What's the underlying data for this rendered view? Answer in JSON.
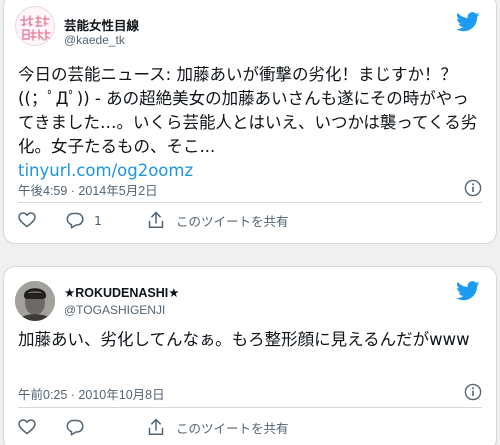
{
  "theme": {
    "background": "#f0f0f0",
    "card_background": "#ffffff",
    "text_color": "#0f1419",
    "secondary_color": "#536471",
    "link_color": "#1b95e0",
    "twitter_blue": "#1d9bf0",
    "avatar_logo_color": "#e8839f"
  },
  "tweets": [
    {
      "avatar": {
        "type": "logo",
        "text": "女性目線"
      },
      "author_name": "芸能女性目線",
      "handle": "@kaede_tk",
      "text": "今日の芸能ニュース: 加藤あいが衝撃の劣化！まじすか！？((；ﾟДﾟ)) - あの超絶美女の加藤あいさんも遂にその時がやってきました…。いくら芸能人とはいえ、いつかは襲ってくる劣化。女子たるもの、そこ...",
      "link": "tinyurl.com/og2oomz",
      "timestamp": "午後4:59 · 2014年5月2日",
      "reply_count": "1",
      "share_label": "このツイートを共有"
    },
    {
      "avatar": {
        "type": "photo"
      },
      "author_name": "★ROKUDENASHI★",
      "handle": "@TOGASHIGENJI",
      "text": "加藤あい、劣化してんなぁ。もろ整形顔に見えるんだがwww",
      "timestamp": "午前0:25 · 2010年10月8日",
      "reply_count": "",
      "share_label": "このツイートを共有"
    }
  ],
  "icons": {
    "brand": "twitter-bird-icon",
    "info": "info-icon",
    "like": "heart-icon",
    "reply": "speech-bubble-icon",
    "share": "upload-arrow-icon"
  }
}
